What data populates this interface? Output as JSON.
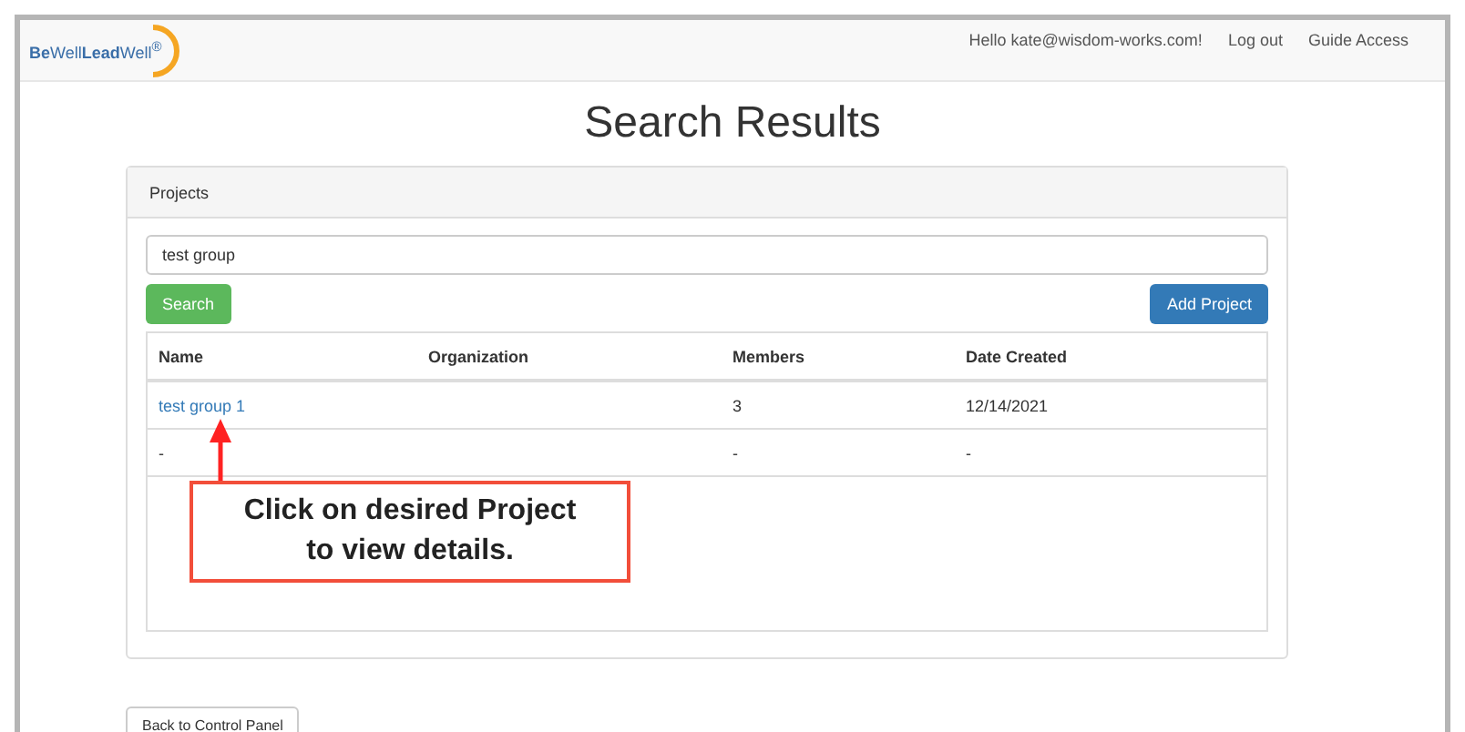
{
  "navbar": {
    "logo": "**Be**Well**Lead**Well$^{®}$",
    "greeting": "Hello kate@wisdom-works.com!",
    "links": [
      "Log out",
      "Guide Access"
    ]
  },
  "title": "Search Results",
  "panel": {
    "heading": "Projects",
    "search": {
      "value": "test group"
    },
    "buttons": [
      {
        "label": "Search",
        "kind": "success"
      },
      {
        "label": "Add Project",
        "kind": "primary"
      }
    ]
  },
  "table": {
    "columns": [
      "Name",
      "Organization",
      "Members",
      "Date Created"
    ],
    "rows": [
      {
        "link": true,
        "cells": [
          "test group 1",
          "",
          "3",
          "12/14/2021"
        ]
      },
      {
        "link": false,
        "cells": [
          "-",
          "",
          "-",
          "-"
        ]
      }
    ]
  },
  "callout": {
    "text": "Click on desired Project to view details."
  },
  "back_button": "Back to Control Panel"
}
